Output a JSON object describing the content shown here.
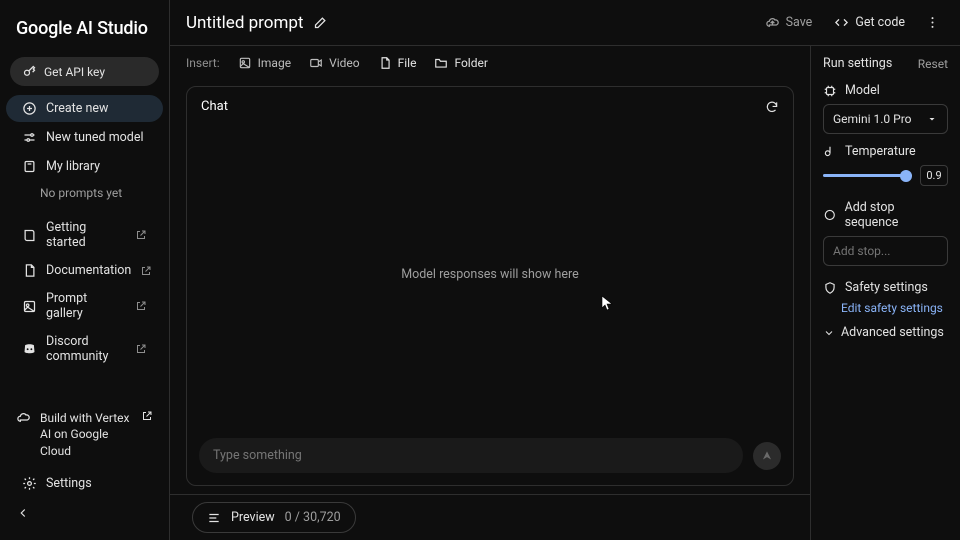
{
  "brand": "Google AI Studio",
  "sidebar": {
    "apiKey": "Get API key",
    "createNew": "Create new",
    "tunedModel": "New tuned model",
    "library": "My library",
    "noPrompts": "No prompts yet",
    "links": {
      "gettingStarted": "Getting started",
      "documentation": "Documentation",
      "gallery": "Prompt gallery",
      "discord": "Discord community"
    },
    "vertex": "Build with Vertex AI on Google Cloud",
    "settings": "Settings"
  },
  "header": {
    "title": "Untitled prompt",
    "save": "Save",
    "getCode": "Get code"
  },
  "insert": {
    "label": "Insert:",
    "image": "Image",
    "video": "Video",
    "file": "File",
    "folder": "Folder"
  },
  "chat": {
    "title": "Chat",
    "empty": "Model responses will show here",
    "placeholder": "Type something"
  },
  "preview": {
    "label": "Preview",
    "count": "0 / 30,720"
  },
  "settings": {
    "title": "Run settings",
    "reset": "Reset",
    "modelLabel": "Model",
    "model": "Gemini 1.0 Pro",
    "tempLabel": "Temperature",
    "temp": "0.9",
    "stopLabel": "Add stop sequence",
    "stopPlaceholder": "Add stop...",
    "safetyLabel": "Safety settings",
    "editSafety": "Edit safety settings",
    "advanced": "Advanced settings"
  }
}
